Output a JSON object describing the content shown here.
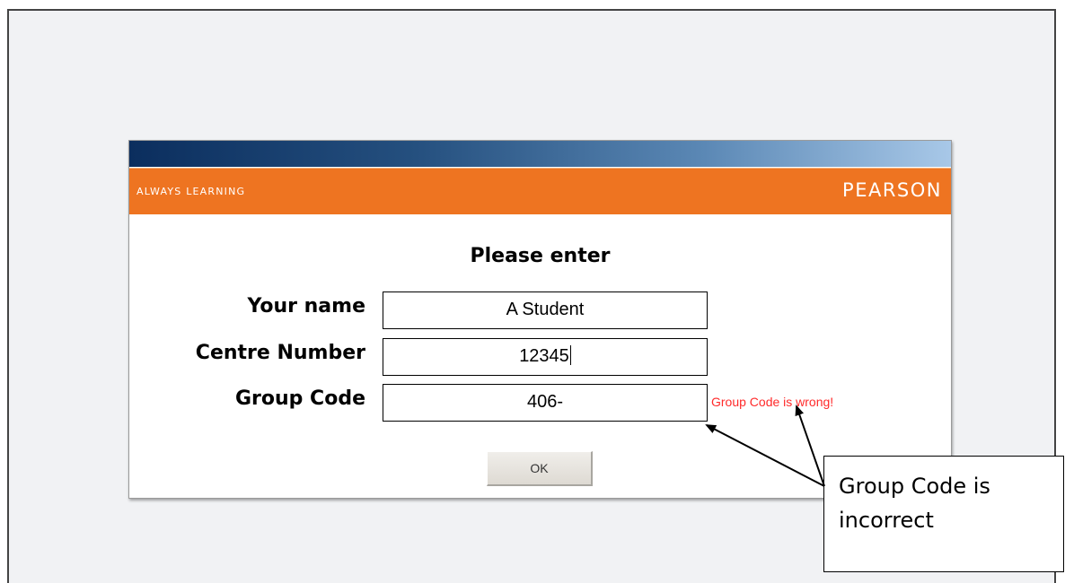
{
  "header": {
    "tagline": "ALWAYS LEARNING",
    "brand": "PEARSON",
    "brand_color": "#ee7421"
  },
  "form": {
    "heading": "Please enter",
    "fields": [
      {
        "label": "Your name",
        "value": "A Student"
      },
      {
        "label": "Centre Number",
        "value": "12345"
      },
      {
        "label": "Group Code",
        "value": "406-"
      }
    ],
    "error": "Group Code is wrong!",
    "error_color": "#ff2a2a",
    "ok_label": "OK"
  },
  "callout": {
    "text": "Group Code is incorrect"
  }
}
